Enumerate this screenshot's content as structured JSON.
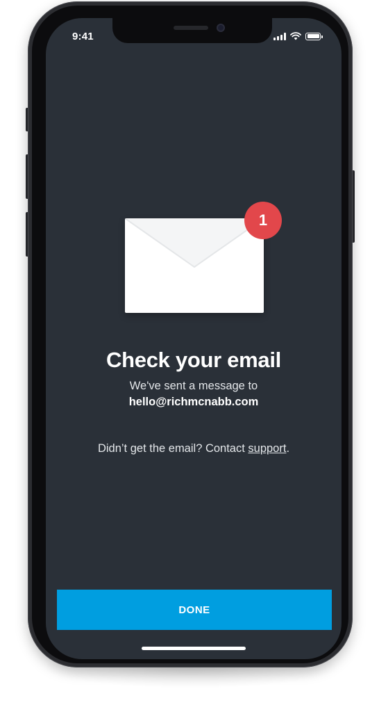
{
  "status_bar": {
    "time": "9:41",
    "icons": [
      "signal-icon",
      "wifi-icon",
      "battery-icon"
    ]
  },
  "illustration": {
    "icon": "envelope-icon",
    "badge_count": "1"
  },
  "content": {
    "title": "Check your email",
    "subtitle": "We've sent a message to",
    "email": "hello@richmcnabb.com",
    "help_prefix": "Didn’t get the email? Contact ",
    "help_link": "support",
    "help_suffix": "."
  },
  "actions": {
    "done_label": "DONE"
  },
  "colors": {
    "screen_background": "#2a3038",
    "accent": "#009ee0",
    "badge": "#e2474b",
    "text": "#ffffff"
  }
}
